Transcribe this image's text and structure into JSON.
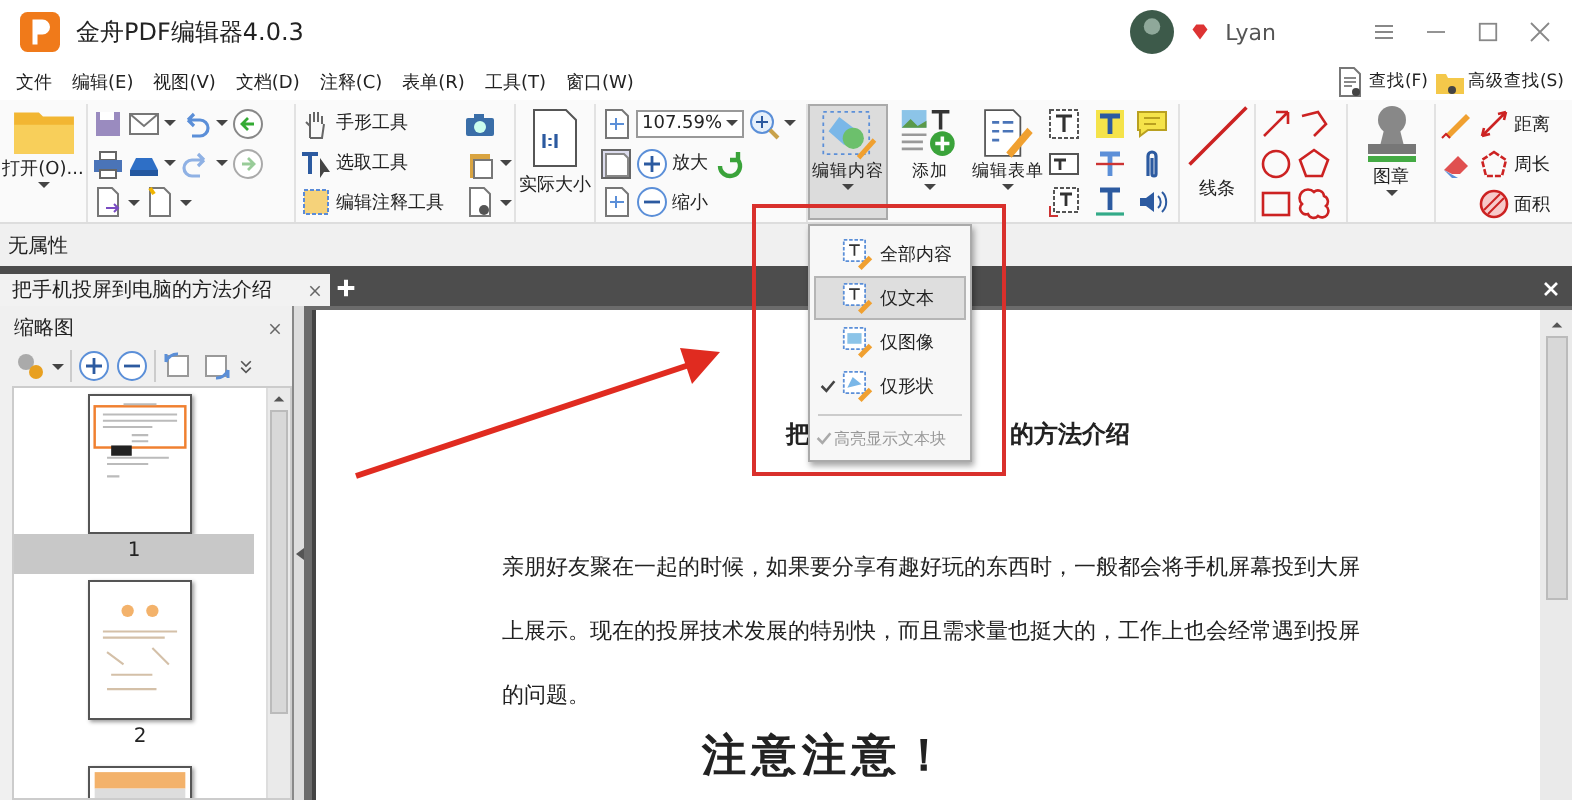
{
  "window": {
    "title": "金舟PDF编辑器4.0.3",
    "user": "Lyan"
  },
  "menu": [
    "文件",
    "编辑(E)",
    "视图(V)",
    "文档(D)",
    "注释(C)",
    "表单(R)",
    "工具(T)",
    "窗口(W)"
  ],
  "search_buttons": [
    "查找(F)",
    "高级查找(S)"
  ],
  "toolbar": {
    "open": "打开(O)...",
    "tools": [
      "手形工具",
      "选取工具",
      "编辑注释工具"
    ],
    "actual_size": "实际大小",
    "zoom": "107.59%",
    "zoom_in": "放大",
    "zoom_out": "缩小",
    "big_buttons": [
      {
        "label": "编辑内容",
        "selected": true
      },
      {
        "label": "添加",
        "selected": false
      },
      {
        "label": "编辑表单",
        "selected": false
      }
    ],
    "lines": "线条",
    "stamp": "图章",
    "measure": [
      "距离",
      "周长",
      "面积"
    ]
  },
  "property_bar": "无属性",
  "tabs": [
    {
      "label": "把手机投屏到电脑的方法介绍",
      "selected": true
    }
  ],
  "thumbnail_panel": {
    "title": "缩略图",
    "pages": [
      {
        "label": "1",
        "selected": true
      },
      {
        "label": "2",
        "selected": false
      }
    ]
  },
  "dropdown": {
    "items": [
      {
        "label": "全部内容",
        "selected": false,
        "checked": false
      },
      {
        "label": "仅文本",
        "selected": true,
        "checked": false
      },
      {
        "label": "仅图像",
        "selected": false,
        "checked": false
      },
      {
        "label": "仅形状",
        "selected": false,
        "checked": true
      }
    ],
    "option": {
      "label": "高亮显示文本块",
      "checked": true,
      "disabled": true
    }
  },
  "document": {
    "title_parts": [
      "把",
      "的方法介绍"
    ],
    "lines": [
      "亲朋好友聚在一起的时候，如果要分享有趣好玩的东西时，一般都会将手机屏幕投到大屏",
      "上展示。现在的投屏技术发展的特别快，而且需求量也挺大的，工作上也会经常遇到投屏",
      "的问题。"
    ],
    "heading": "注意注意！"
  }
}
